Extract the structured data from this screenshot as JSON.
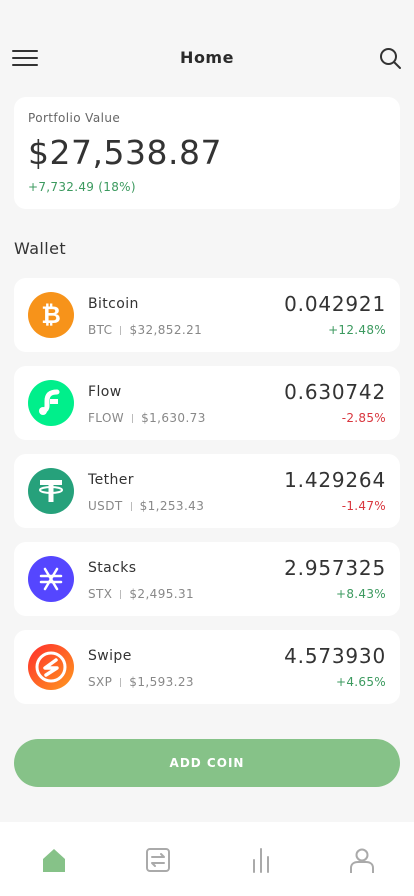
{
  "header": {
    "title": "Home"
  },
  "portfolio": {
    "label": "Portfolio Value",
    "value": "$27,538.87",
    "change": "+7,732.49 (18%)"
  },
  "wallet": {
    "title": "Wallet",
    "coins": [
      {
        "name": "Bitcoin",
        "symbol": "BTC",
        "price": "$32,852.21",
        "amount": "0.042921",
        "change": "+12.48%",
        "trend": "up",
        "color": "#f7931a",
        "icon": "bitcoin-icon"
      },
      {
        "name": "Flow",
        "symbol": "FLOW",
        "price": "$1,630.73",
        "amount": "0.630742",
        "change": "-2.85%",
        "trend": "down",
        "color": "#00ef8b",
        "icon": "flow-icon"
      },
      {
        "name": "Tether",
        "symbol": "USDT",
        "price": "$1,253.43",
        "amount": "1.429264",
        "change": "-1.47%",
        "trend": "down",
        "color": "#26a17b",
        "icon": "tether-icon"
      },
      {
        "name": "Stacks",
        "symbol": "STX",
        "price": "$2,495.31",
        "amount": "2.957325",
        "change": "+8.43%",
        "trend": "up",
        "color": "#5546ff",
        "icon": "stacks-icon"
      },
      {
        "name": "Swipe",
        "symbol": "SXP",
        "price": "$1,593.23",
        "amount": "4.573930",
        "change": "+4.65%",
        "trend": "up",
        "color": "#ff4d1f",
        "icon": "swipe-icon"
      }
    ]
  },
  "add_button": {
    "label": "ADD COIN"
  },
  "colors": {
    "accent": "#86c288",
    "positive": "#3c9a5f",
    "negative": "#d9363e"
  },
  "tabbar": {
    "items": [
      {
        "icon": "home-icon",
        "active": true
      },
      {
        "icon": "exchange-icon",
        "active": false
      },
      {
        "icon": "chart-icon",
        "active": false
      },
      {
        "icon": "profile-icon",
        "active": false
      }
    ]
  }
}
